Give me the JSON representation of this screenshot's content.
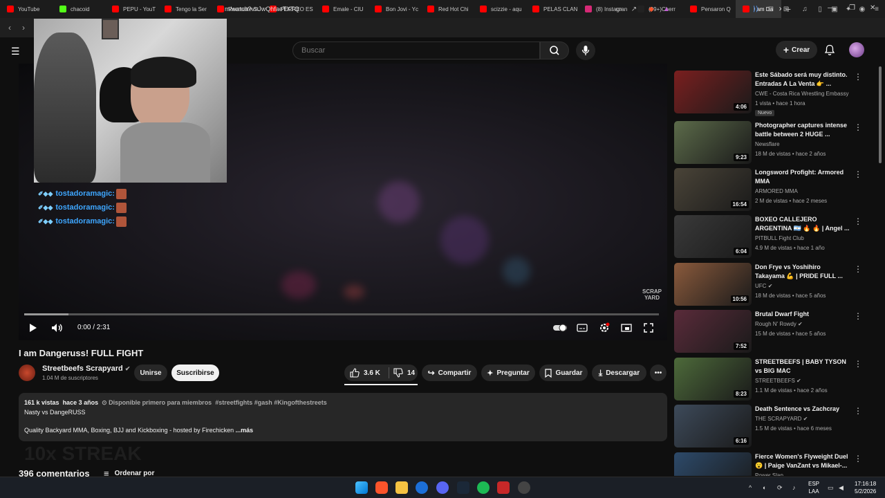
{
  "browser": {
    "tabs": [
      {
        "label": "YouTube",
        "color": "#ff0000"
      },
      {
        "label": "chacoid",
        "color": "#53fc18"
      },
      {
        "label": "PEPU - YouT",
        "color": "#ff0000"
      },
      {
        "label": "Tengo la Ser",
        "color": "#ff0000"
      },
      {
        "label": "Recreaite St",
        "color": "#ff0000"
      },
      {
        "label": "PERREO ES",
        "color": "#ff0000"
      },
      {
        "label": "Emale - CIU",
        "color": "#ff0000"
      },
      {
        "label": "Bon Jovi - Yc",
        "color": "#ff0000"
      },
      {
        "label": "Red Hot Chi",
        "color": "#ff0000"
      },
      {
        "label": "scizzie - aqu",
        "color": "#ff0000"
      },
      {
        "label": "PELAS CLAN",
        "color": "#ff0000"
      },
      {
        "label": "(8) Instagran",
        "color": "#d62976"
      },
      {
        "label": "(99+)Cherr",
        "color": "#222222"
      },
      {
        "label": "Pensaron Q",
        "color": "#ff0000"
      }
    ],
    "active_tab": "I am Da",
    "url": "m/watch?v=JwQhfaeTXTQ"
  },
  "header": {
    "search_placeholder": "Buscar",
    "create_label": "Crear"
  },
  "player": {
    "chat": [
      {
        "user": "tostadoramagic:"
      },
      {
        "user": "tostadoramagic:"
      },
      {
        "user": "tostadoramagic:"
      }
    ],
    "watermark_line1": "SCRAP",
    "watermark_line2": "YARD",
    "time": "0:00 / 2:31",
    "progress_loaded": 0.07
  },
  "video": {
    "title": "I am Dangeruss! FULL FIGHT",
    "channel": "Streetbeefs Scrapyard",
    "subscribers": "1.04 M de suscriptores",
    "join_label": "Unirse",
    "subscribe_label": "Suscribirse",
    "likes": "3.6 K",
    "dislikes": "14",
    "share_label": "Compartir",
    "ask_label": "Preguntar",
    "save_label": "Guardar",
    "download_label": "Descargar"
  },
  "description": {
    "views": "161 k vistas",
    "age": "hace 3 años",
    "members": "Disponible primero para miembros",
    "hashtags": "#streetfights #gash #Kingofthestreets",
    "line1": "Nasty vs DangeRUSS",
    "line2": "Quality Backyard MMA, Boxing, BJJ and Kickboxing -  hosted by Firechicken",
    "more": "...más"
  },
  "streak": "10x STREAK",
  "comments": {
    "count": "396 comentarios",
    "sort_label": "Ordenar por"
  },
  "recommendations": [
    {
      "title": "Este Sábado será muy distinto. Entradas A La Venta 👉 ...",
      "channel": "CWE - Costa Rica Wrestling Embassy",
      "meta": "1 vista • hace 1 hora",
      "duration": "4:06",
      "badge": "Nuevo",
      "verified": false,
      "thumb": "#7a1f1f"
    },
    {
      "title": "Photographer captures intense battle between 2 HUGE ...",
      "channel": "Newsflare",
      "meta": "18 M de vistas • hace 2 años",
      "duration": "9:23",
      "verified": false,
      "thumb": "#5c6b4a"
    },
    {
      "title": "Longsword Profight: Armored MMA",
      "channel": "ARMORED MMA",
      "meta": "2 M de vistas • hace 2 meses",
      "duration": "16:54",
      "verified": false,
      "thumb": "#4a4438"
    },
    {
      "title": "BOXEO CALLEJERO ARGENTINA 🇦🇷 🔥 🔥 | Angel ...",
      "channel": "PITBULL Fight Club",
      "meta": "4.9 M de vistas • hace 1 año",
      "duration": "6:04",
      "verified": false,
      "thumb": "#3a3a3a"
    },
    {
      "title": "Don Frye vs Yoshihiro Takayama 💪 | PRIDE FULL ...",
      "channel": "UFC",
      "meta": "18 M de vistas • hace 5 años",
      "duration": "10:56",
      "verified": true,
      "thumb": "#8a5a3c"
    },
    {
      "title": "Brutal Dwarf Fight",
      "channel": "Rough N' Rowdy",
      "meta": "15 M de vistas • hace 5 años",
      "duration": "7:52",
      "verified": true,
      "thumb": "#5a2b3a"
    },
    {
      "title": "STREETBEEFS | BABY TYSON vs BIG MAC",
      "channel": "STREETBEEFS",
      "meta": "1.1 M de vistas • hace 2 años",
      "duration": "8:23",
      "verified": true,
      "thumb": "#4d6a3a"
    },
    {
      "title": "Death Sentence vs Zachcray",
      "channel": "THE SCRAPYARD",
      "meta": "1.5 M de vistas • hace 6 meses",
      "duration": "6:16",
      "verified": true,
      "thumb": "#3d4a5a"
    },
    {
      "title": "Fierce Women's Flyweight Duel 😮 | Paige VanZant vs Mikael-...",
      "channel": "Power Slap",
      "meta": "",
      "duration": "",
      "verified": false,
      "thumb": "#2d4a6a"
    }
  ],
  "taskbar": {
    "lang1": "ESP",
    "lang2": "LAA",
    "time": "17:16:18",
    "date": "5/2/2026"
  }
}
